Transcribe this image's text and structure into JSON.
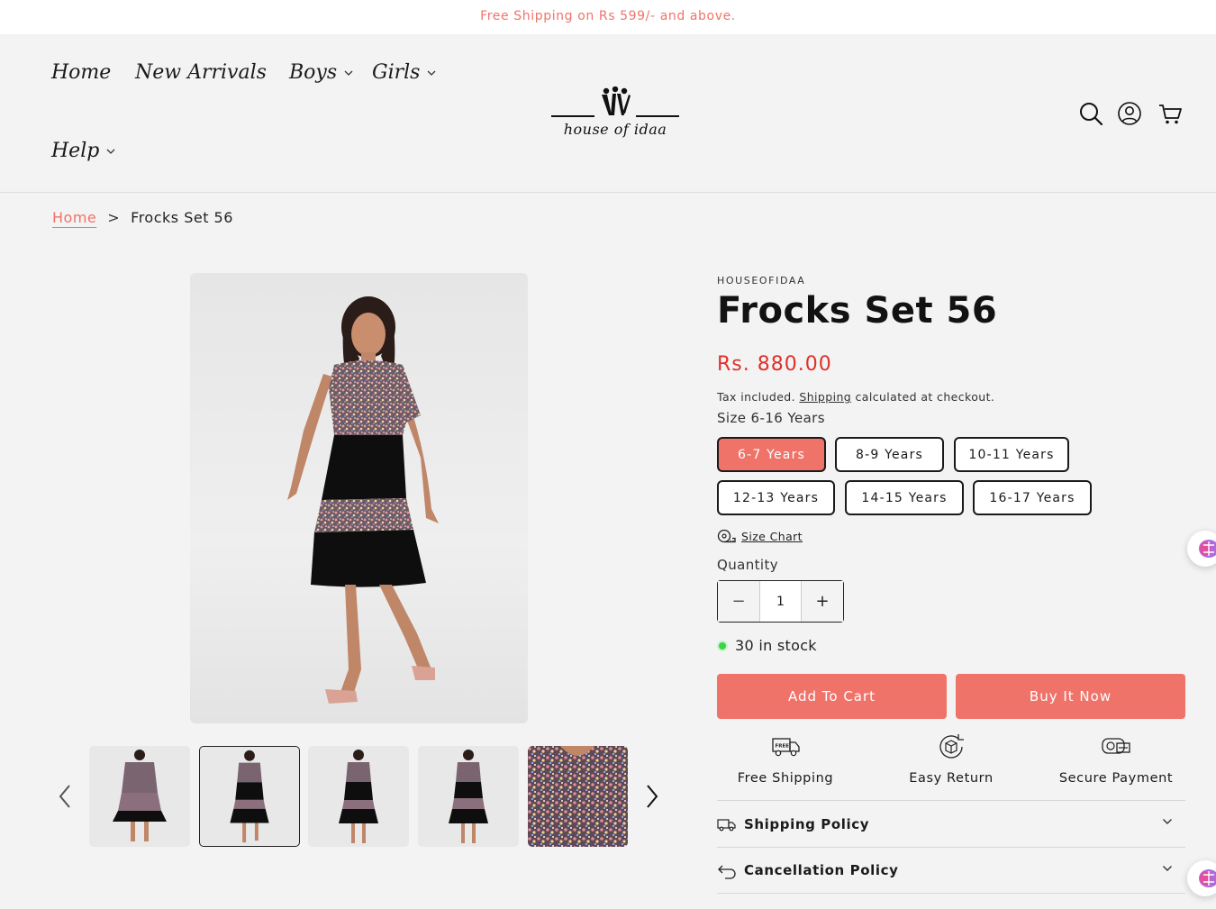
{
  "announcement": "Free Shipping on Rs 599/- and above.",
  "nav": {
    "home": "Home",
    "new_arrivals": "New Arrivals",
    "boys": "Boys",
    "girls": "Girls",
    "help": "Help"
  },
  "logo": {
    "text": "house of idaa"
  },
  "header_icons": [
    "search-icon",
    "account-icon",
    "cart-icon"
  ],
  "breadcrumb": {
    "home": "Home",
    "separator": ">",
    "current": "Frocks Set 56"
  },
  "product": {
    "vendor": "HOUSEOFIDAA",
    "title": "Frocks Set 56",
    "price": "Rs. 880.00",
    "tax_prefix": "Tax included.",
    "tax_link": "Shipping",
    "tax_suffix": "calculated at checkout.",
    "size_label": "Size 6-16 Years",
    "sizes": [
      "6-7 Years",
      "8-9 Years",
      "10-11 Years",
      "12-13 Years",
      "14-15 Years",
      "16-17 Years"
    ],
    "selected_size": "6-7 Years",
    "size_chart": "Size Chart",
    "quantity_label": "Quantity",
    "quantity": "1",
    "qty_minus": "−",
    "qty_plus": "+",
    "stock": "30 in stock",
    "add_to_cart": "Add To Cart",
    "buy_now": "Buy It Now"
  },
  "features": [
    {
      "label": "Free Shipping",
      "icon": "delivery-truck-icon"
    },
    {
      "label": "Easy Return",
      "icon": "return-box-icon"
    },
    {
      "label": "Secure Payment",
      "icon": "secure-payment-icon"
    }
  ],
  "policies": [
    {
      "label": "Shipping Policy",
      "icon": "truck-outline-icon"
    },
    {
      "label": "Cancellation Policy",
      "icon": "return-arrow-icon"
    }
  ],
  "colors": {
    "accent": "#f0736a",
    "price_red": "#e0302b",
    "stock_green": "#3ed14a",
    "background": "#f3f3f3"
  }
}
